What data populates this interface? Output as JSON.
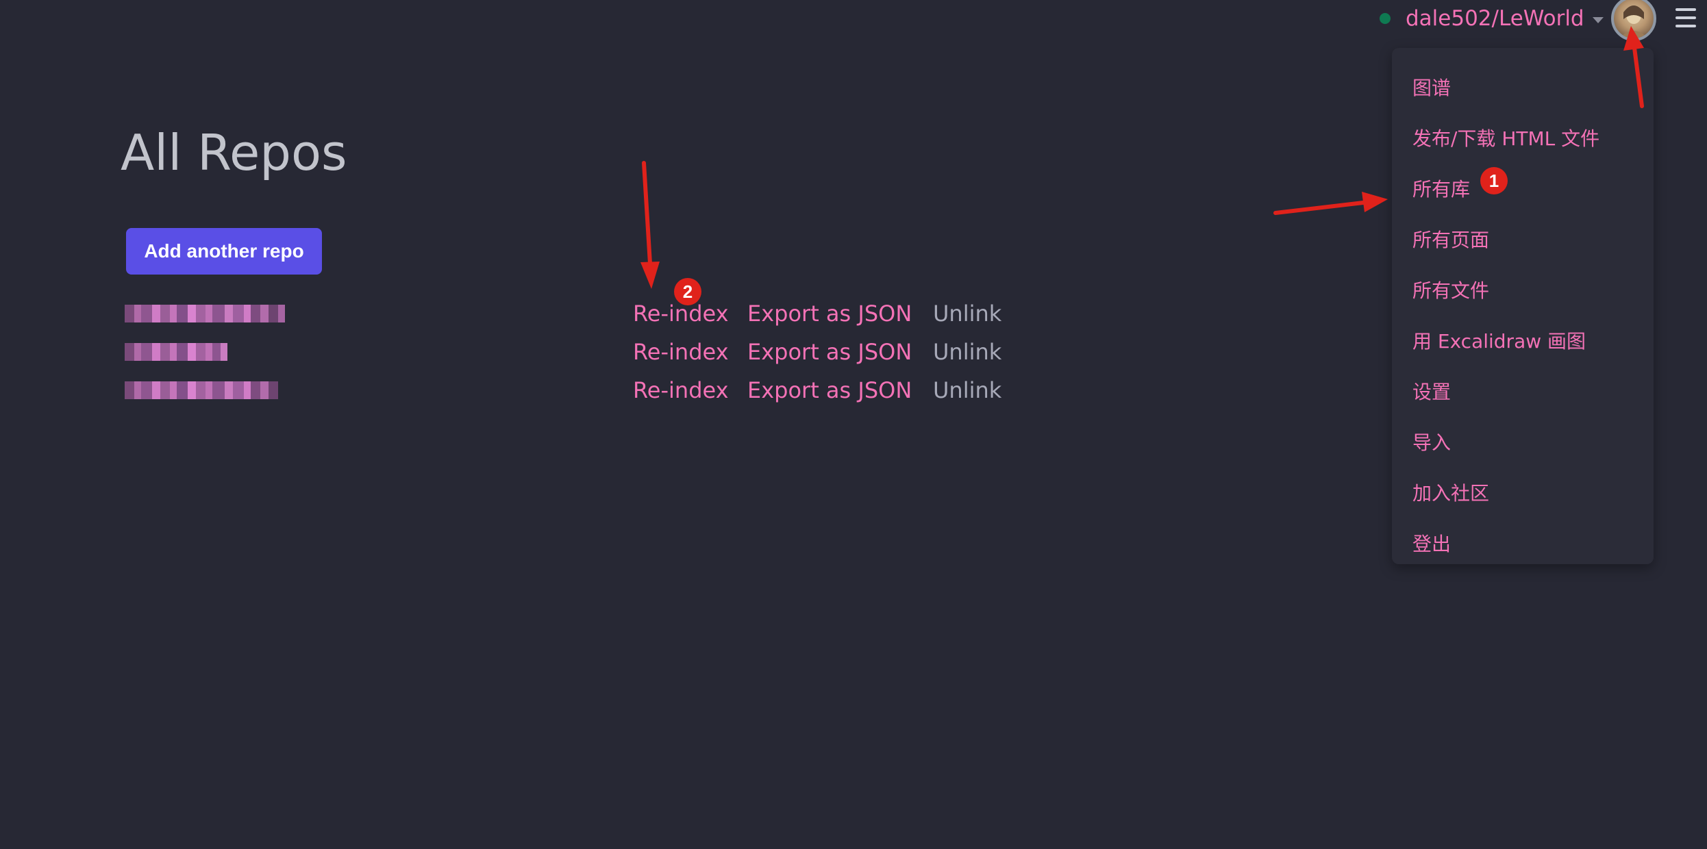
{
  "header": {
    "repo_label": "dale502/LeWorld",
    "status_color": "#0f7a52"
  },
  "menu": {
    "items": [
      {
        "label": "图谱"
      },
      {
        "label": "发布/下载 HTML 文件"
      },
      {
        "label": "所有库"
      },
      {
        "label": "所有页面"
      },
      {
        "label": "所有文件"
      },
      {
        "label": "用 Excalidraw 画图"
      },
      {
        "label": "设置"
      },
      {
        "label": "导入"
      },
      {
        "label": "加入社区"
      },
      {
        "label": "登出"
      }
    ]
  },
  "main": {
    "title": "All Repos",
    "add_button": "Add another repo",
    "repos": [
      {
        "name": "[pixelated]",
        "actions": {
          "reindex": "Re-index",
          "export": "Export as JSON",
          "unlink": "Unlink"
        }
      },
      {
        "name": "[pixelated]",
        "actions": {
          "reindex": "Re-index",
          "export": "Export as JSON",
          "unlink": "Unlink"
        }
      },
      {
        "name": "[pixelated]",
        "actions": {
          "reindex": "Re-index",
          "export": "Export as JSON",
          "unlink": "Unlink"
        }
      }
    ]
  },
  "annotations": {
    "badges": [
      "1",
      "2"
    ],
    "color": "#e0221b"
  },
  "colors": {
    "background": "#272834",
    "accent_link": "#f472b6",
    "button": "#5a4fe6",
    "muted_link": "#a7a9b8"
  },
  "icons": [
    "status-dot",
    "chevron-down-icon",
    "avatar",
    "hamburger-menu-icon"
  ]
}
